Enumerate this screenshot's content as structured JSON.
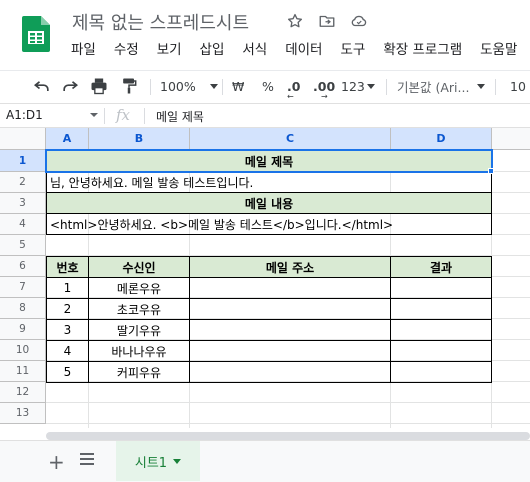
{
  "document": {
    "title": "제목 없는 스프레드시트"
  },
  "menu": [
    "파일",
    "수정",
    "보기",
    "삽입",
    "서식",
    "데이터",
    "도구",
    "확장 프로그램",
    "도움말"
  ],
  "toolbar": {
    "zoom": "100%",
    "currency": "₩",
    "percent": "%",
    "decimal_decrease": ".0",
    "decimal_increase": ".00",
    "number_format": "123",
    "font": "기본값 (Ari...",
    "font_size": "10"
  },
  "formula_bar": {
    "name_box": "A1:D1",
    "fx": "fx",
    "content": "메일 제목"
  },
  "grid": {
    "columns": [
      "A",
      "B",
      "C",
      "D"
    ],
    "rows": [
      "1",
      "2",
      "3",
      "4",
      "5",
      "6",
      "7",
      "8",
      "9",
      "10",
      "11",
      "12",
      "13"
    ],
    "row1_title": "메일 제목",
    "row2_text": "님, 안녕하세요. 메일 발송 테스트입니다.",
    "row3_title": "메일 내용",
    "row4_text": "<html>안녕하세요. <b>메일 발송 테스트</b>입니다.</html>",
    "table_headers": [
      "번호",
      "수신인",
      "메일 주소",
      "결과"
    ],
    "table_rows": [
      {
        "num": "1",
        "name": "메론우유"
      },
      {
        "num": "2",
        "name": "초코우유"
      },
      {
        "num": "3",
        "name": "딸기우유"
      },
      {
        "num": "4",
        "name": "바나나우유"
      },
      {
        "num": "5",
        "name": "커피우유"
      }
    ]
  },
  "sheets": {
    "active": "시트1"
  },
  "colors": {
    "header_fill": "#d9ead3",
    "selection": "#1a73e8",
    "sheet_tab_text": "#188038"
  }
}
